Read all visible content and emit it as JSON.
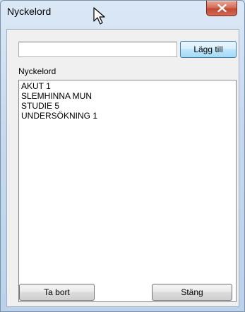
{
  "window": {
    "title": "Nyckelord"
  },
  "form": {
    "keyword_value": "",
    "add_label": "Lägg till",
    "list_label": "Nyckelord"
  },
  "keywords": [
    "AKUT 1",
    "SLEMHINNA MUN",
    "STUDIE 5",
    "UNDERSÖKNING 1"
  ],
  "footer": {
    "remove_label": "Ta bort",
    "close_label": "Stäng"
  },
  "icons": {
    "close": "close-icon",
    "cursor": "cursor-icon"
  },
  "colors": {
    "close_button": "#c24a35",
    "titlebar": "#dbe8f6",
    "client": "#f0f0f0"
  }
}
